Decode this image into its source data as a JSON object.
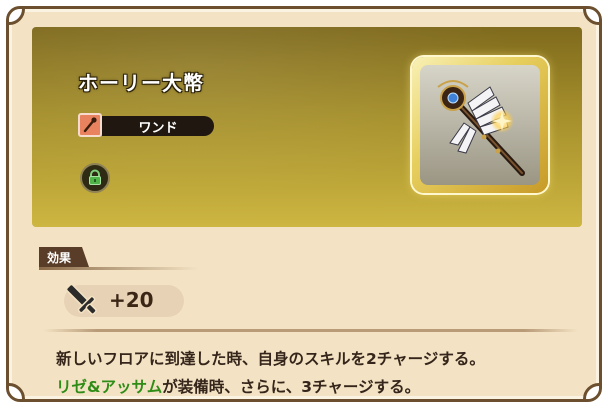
{
  "item": {
    "name": "ホーリー大幣",
    "type_label": "ワンド",
    "type_icon": "wand-icon",
    "lock_icon": "lock-icon",
    "frame_color": "#e7cf5e"
  },
  "effect": {
    "section_label": "効果",
    "stat_icon": "sword-icon",
    "stat_value": "+20",
    "description_line1": "新しいフロアに到達した時、自身のスキルを2チャージする。",
    "description_highlight": "リゼ&アッサム",
    "description_line2_rest": "が装備時、さらに、3チャージする。",
    "highlight_color": "#2f8c17"
  }
}
